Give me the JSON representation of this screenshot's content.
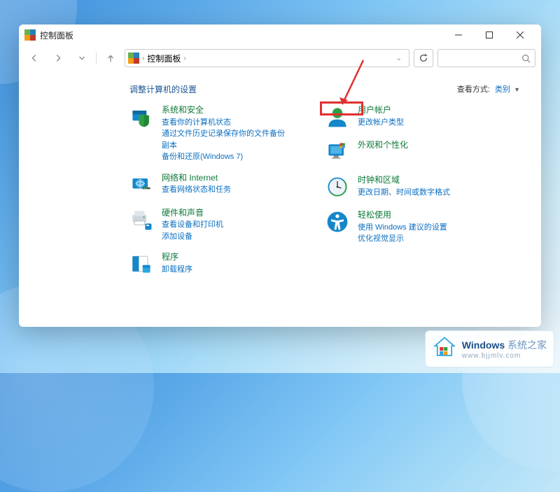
{
  "window": {
    "title": "控制面板"
  },
  "breadcrumb": {
    "root": "控制面板"
  },
  "heading": "调整计算机的设置",
  "viewby": {
    "label": "查看方式:",
    "value": "类别"
  },
  "left_categories": [
    {
      "title": "系统和安全",
      "subs": [
        "查看你的计算机状态",
        "通过文件历史记录保存你的文件备份副本",
        "备份和还原(Windows 7)"
      ]
    },
    {
      "title": "网络和 Internet",
      "subs": [
        "查看网络状态和任务"
      ]
    },
    {
      "title": "硬件和声音",
      "subs": [
        "查看设备和打印机",
        "添加设备"
      ]
    },
    {
      "title": "程序",
      "subs": [
        "卸载程序"
      ]
    }
  ],
  "right_categories": [
    {
      "title": "用户帐户",
      "subs": [
        "更改帐户类型"
      ]
    },
    {
      "title": "外观和个性化",
      "subs": []
    },
    {
      "title": "时钟和区域",
      "subs": [
        "更改日期、时间或数字格式"
      ]
    },
    {
      "title": "轻松使用",
      "subs": [
        "使用 Windows 建议的设置",
        "优化视觉显示"
      ]
    }
  ],
  "watermark": {
    "brand": "Windows",
    "suffix": "系统之家",
    "url": "www.bjjmlv.com"
  }
}
